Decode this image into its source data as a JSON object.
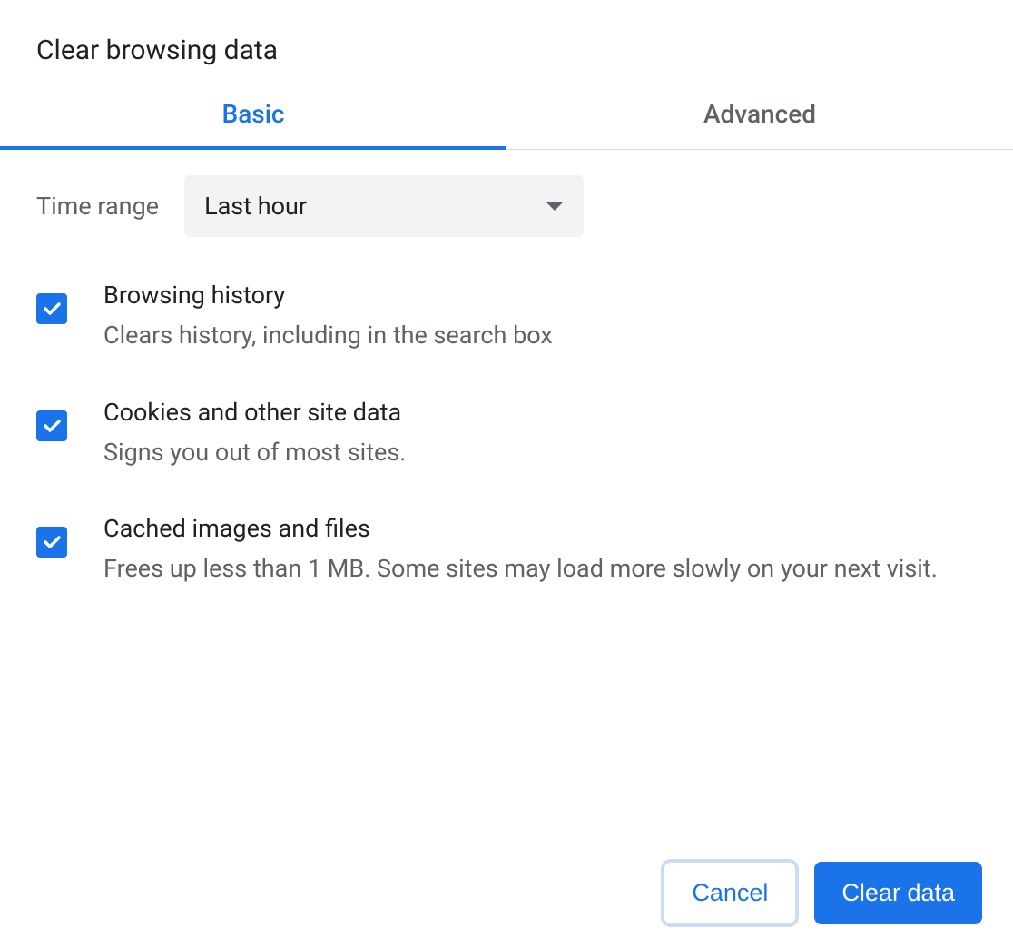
{
  "dialog": {
    "title": "Clear browsing data"
  },
  "tabs": {
    "basic": "Basic",
    "advanced": "Advanced"
  },
  "timeRange": {
    "label": "Time range",
    "selected": "Last hour"
  },
  "options": [
    {
      "title": "Browsing history",
      "description": "Clears history, including in the search box",
      "checked": true
    },
    {
      "title": "Cookies and other site data",
      "description": "Signs you out of most sites.",
      "checked": true
    },
    {
      "title": "Cached images and files",
      "description": "Frees up less than 1 MB. Some sites may load more slowly on your next visit.",
      "checked": true
    }
  ],
  "actions": {
    "cancel": "Cancel",
    "clear": "Clear data"
  }
}
